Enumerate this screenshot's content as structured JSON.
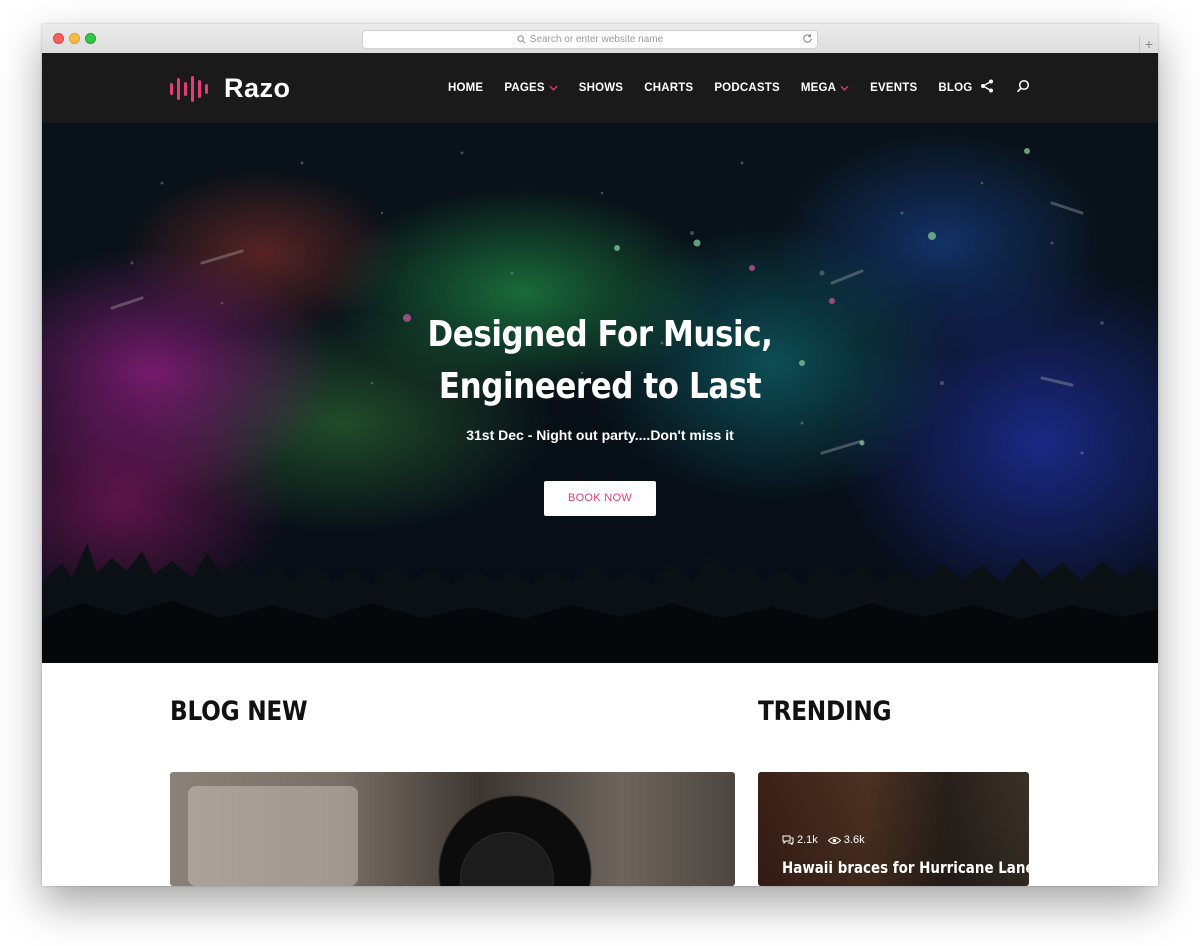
{
  "browser": {
    "url_placeholder": "Search or enter website name",
    "new_tab": "+"
  },
  "header": {
    "logo": "Razo",
    "nav": [
      {
        "label": "HOME"
      },
      {
        "label": "PAGES"
      },
      {
        "label": "SHOWS"
      },
      {
        "label": "CHARTS"
      },
      {
        "label": "PODCASTS"
      },
      {
        "label": "MEGA"
      },
      {
        "label": "EVENTS"
      },
      {
        "label": "BLOG"
      }
    ],
    "icons": [
      "share-icon",
      "search-icon"
    ]
  },
  "hero": {
    "title_line1": "Designed For Music,",
    "title_line2": "Engineered to Last",
    "subtitle": "31st Dec - Night out party....Don't miss it",
    "button": "BOOK NOW"
  },
  "sections": {
    "blog_title": "BLOG NEW",
    "trending_title": "TRENDING"
  },
  "trending_card": {
    "comments": "2.1k",
    "views": "3.6k",
    "title": "Hawaii braces for Hurricane Lane"
  },
  "colors": {
    "accent": "#e33d77",
    "header_bg": "#1a1a1a"
  }
}
